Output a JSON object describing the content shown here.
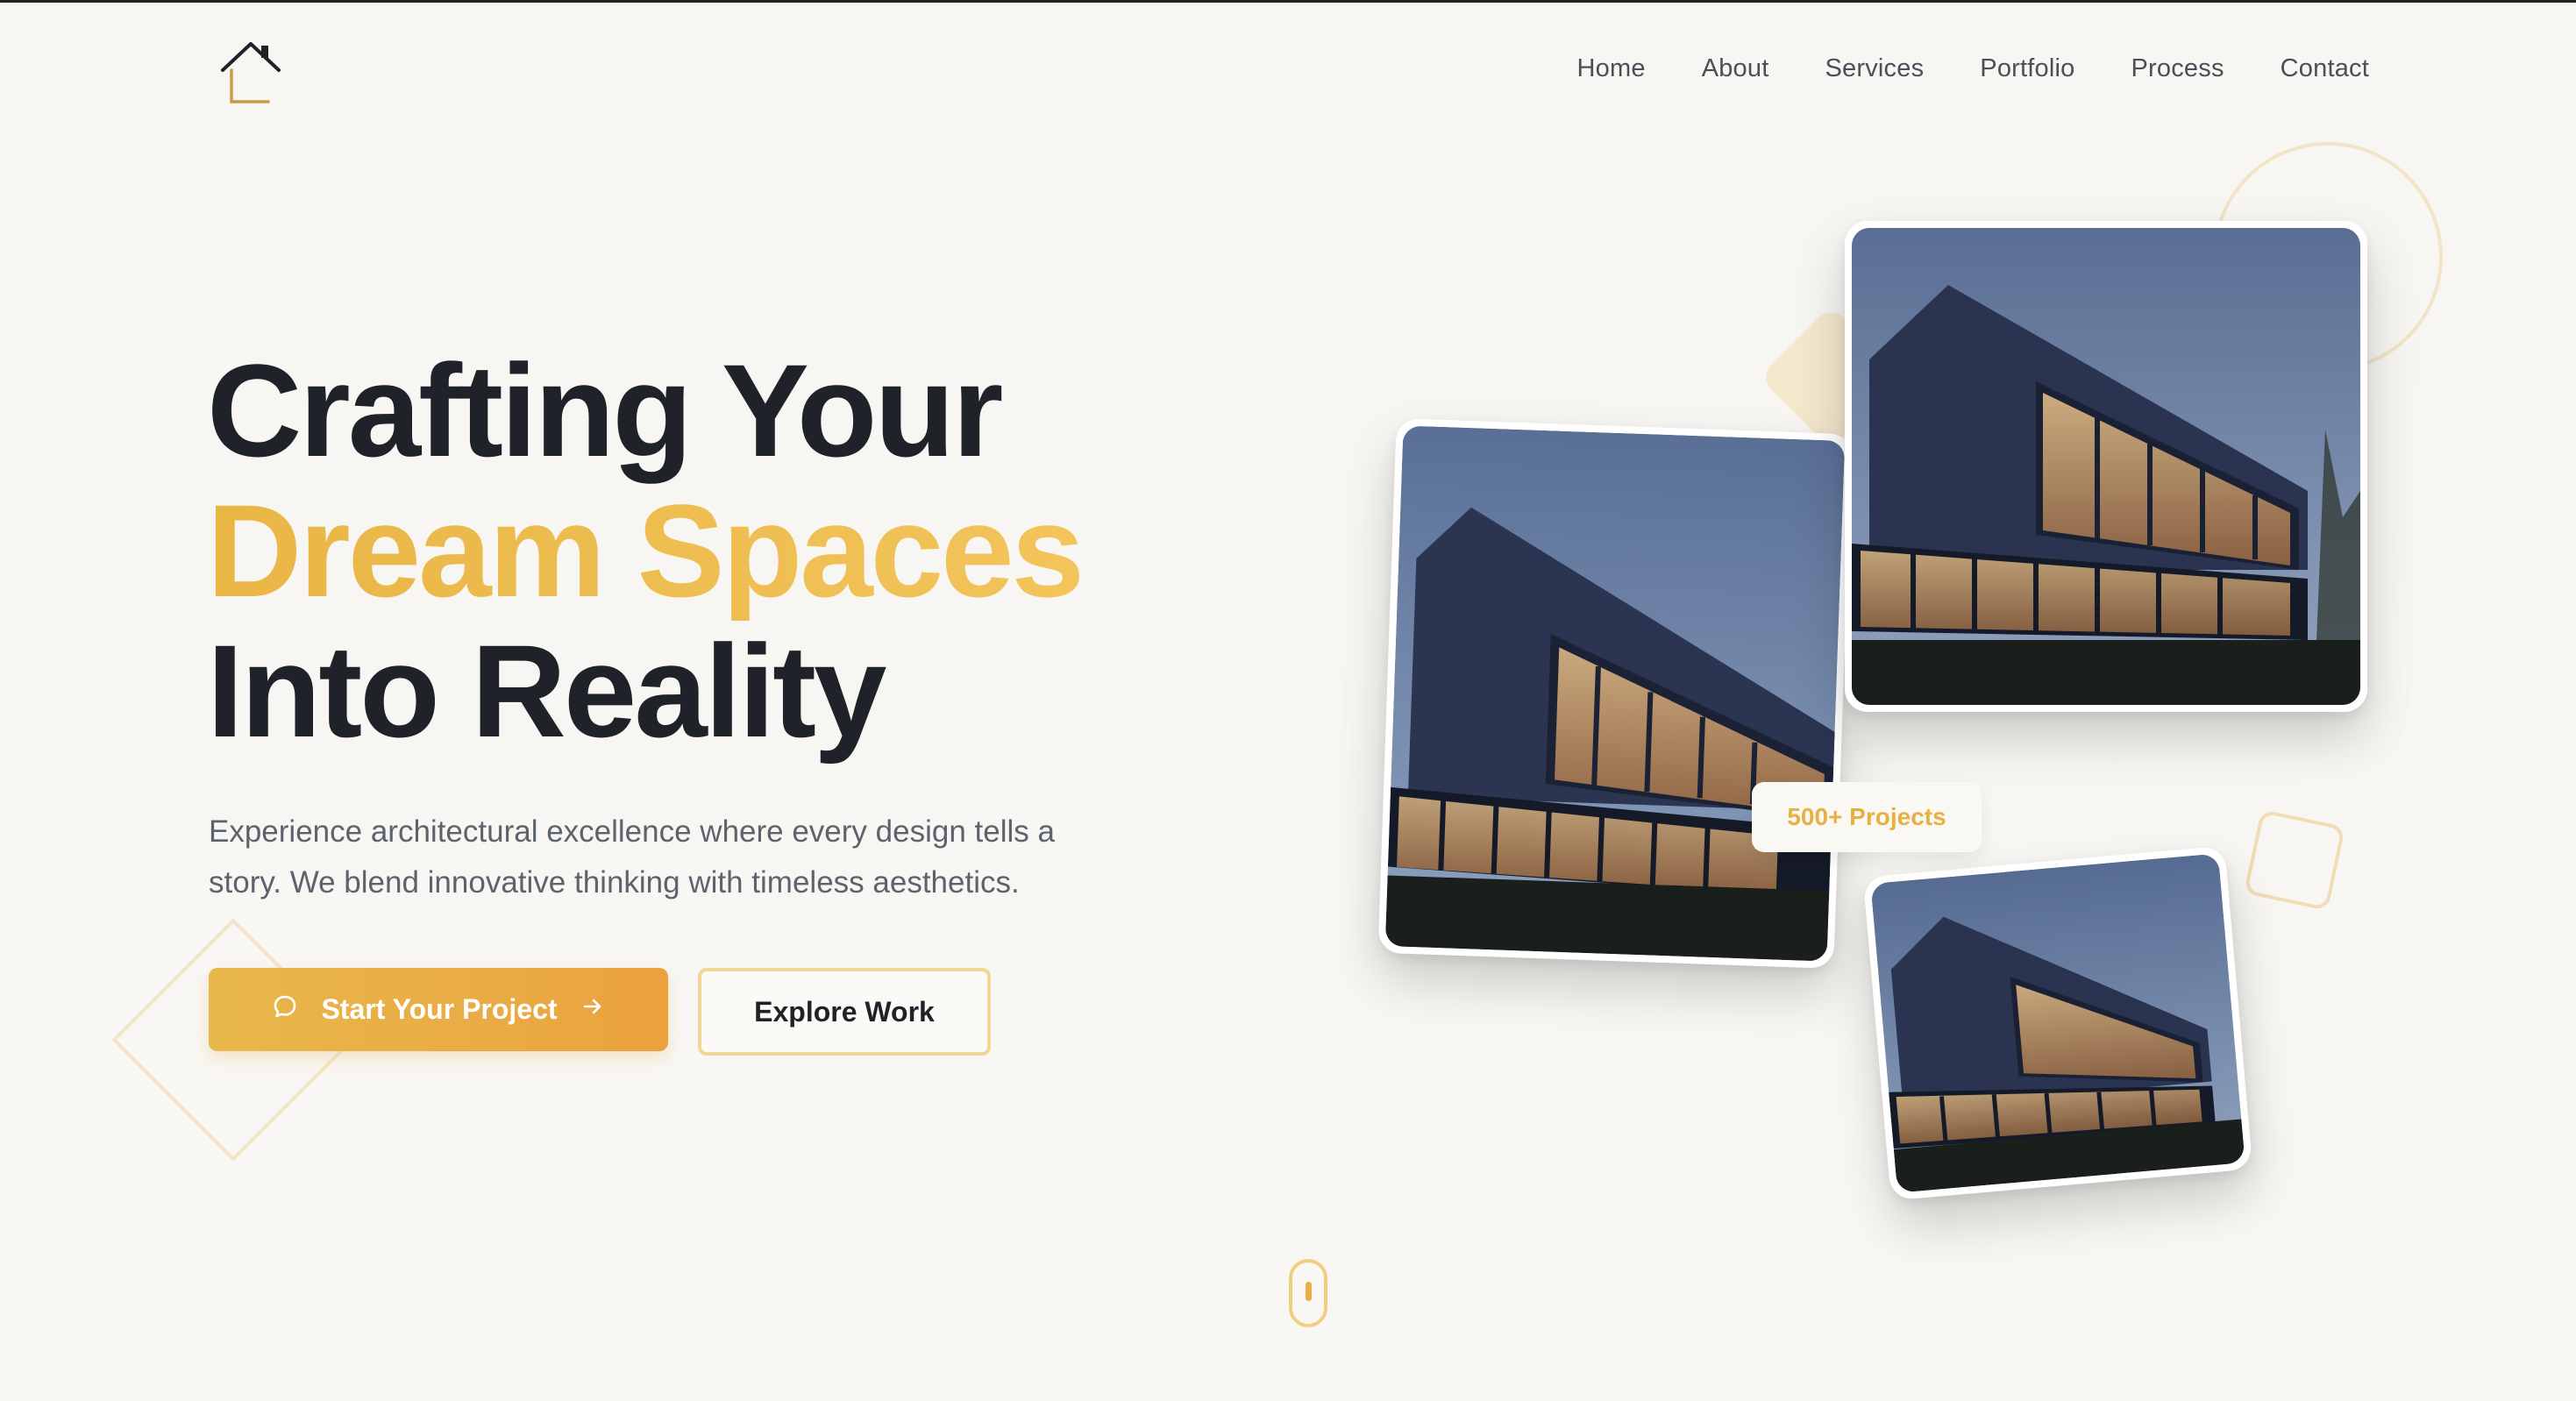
{
  "nav": {
    "items": [
      "Home",
      "About",
      "Services",
      "Portfolio",
      "Process",
      "Contact"
    ]
  },
  "hero": {
    "headline_line1": "Crafting Your",
    "headline_line2": "Dream Spaces",
    "headline_line3": "Into Reality",
    "subtext": "Experience architectural excellence where every design tells a story. We blend innovative thinking with timeless aesthetics.",
    "primary_button": "Start Your Project",
    "secondary_button": "Explore Work"
  },
  "badge": {
    "label": "500+ Projects"
  },
  "icons": {
    "logo": "house-logo-icon",
    "primary_button_leading": "chat-bubble-icon",
    "primary_button_trailing": "arrow-right-icon",
    "scroll": "mouse-scroll-icon"
  },
  "colors": {
    "accent": "#e9b646",
    "button_start": "#e8b84c",
    "button_end": "#eba23e",
    "headline": "#1f2229",
    "background": "#f8f6f2"
  }
}
